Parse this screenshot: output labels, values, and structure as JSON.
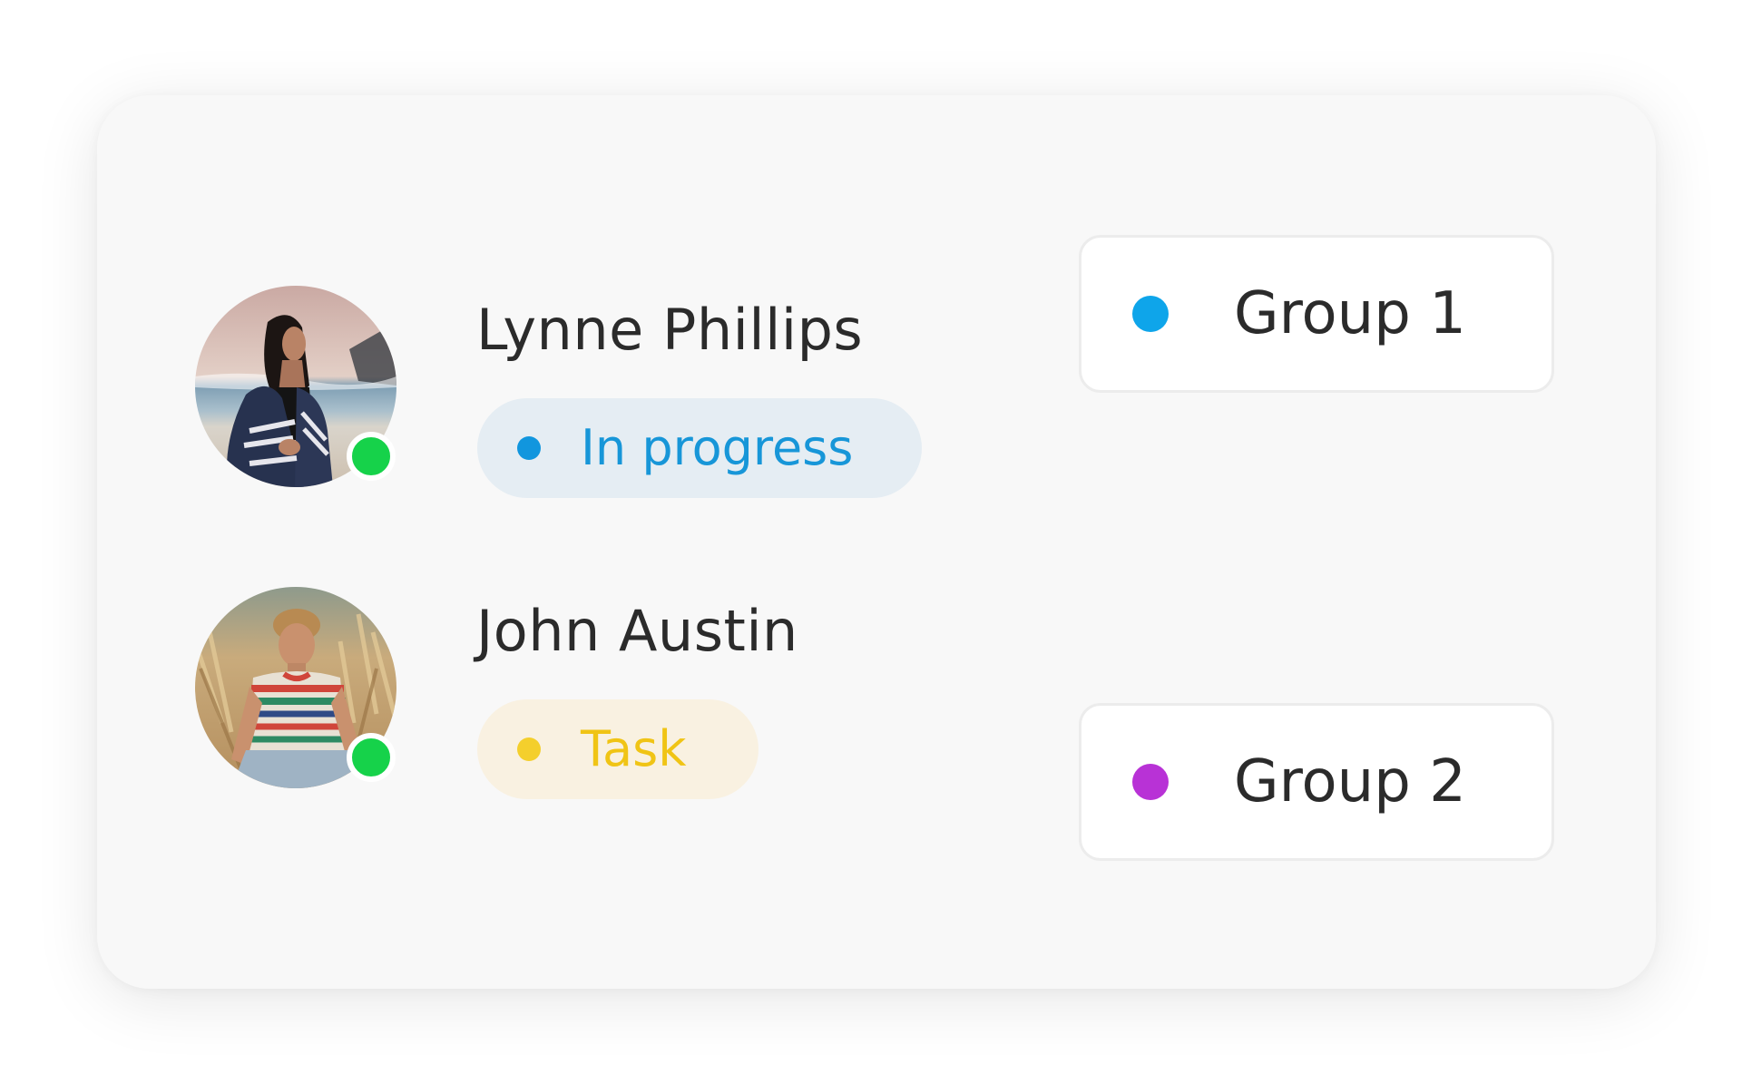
{
  "people": [
    {
      "name": "Lynne Phillips",
      "status": "In progress",
      "status_color": "#1796d8",
      "online": true,
      "group": "Group 1",
      "group_color": "#0ea5ea"
    },
    {
      "name": "John Austin",
      "status": "Task",
      "status_color": "#f0c415",
      "online": true,
      "group": "Group 2",
      "group_color": "#b832d6"
    }
  ],
  "colors": {
    "card_background": "#f8f8f8",
    "online": "#16d24a",
    "text": "#2b2b2b"
  }
}
